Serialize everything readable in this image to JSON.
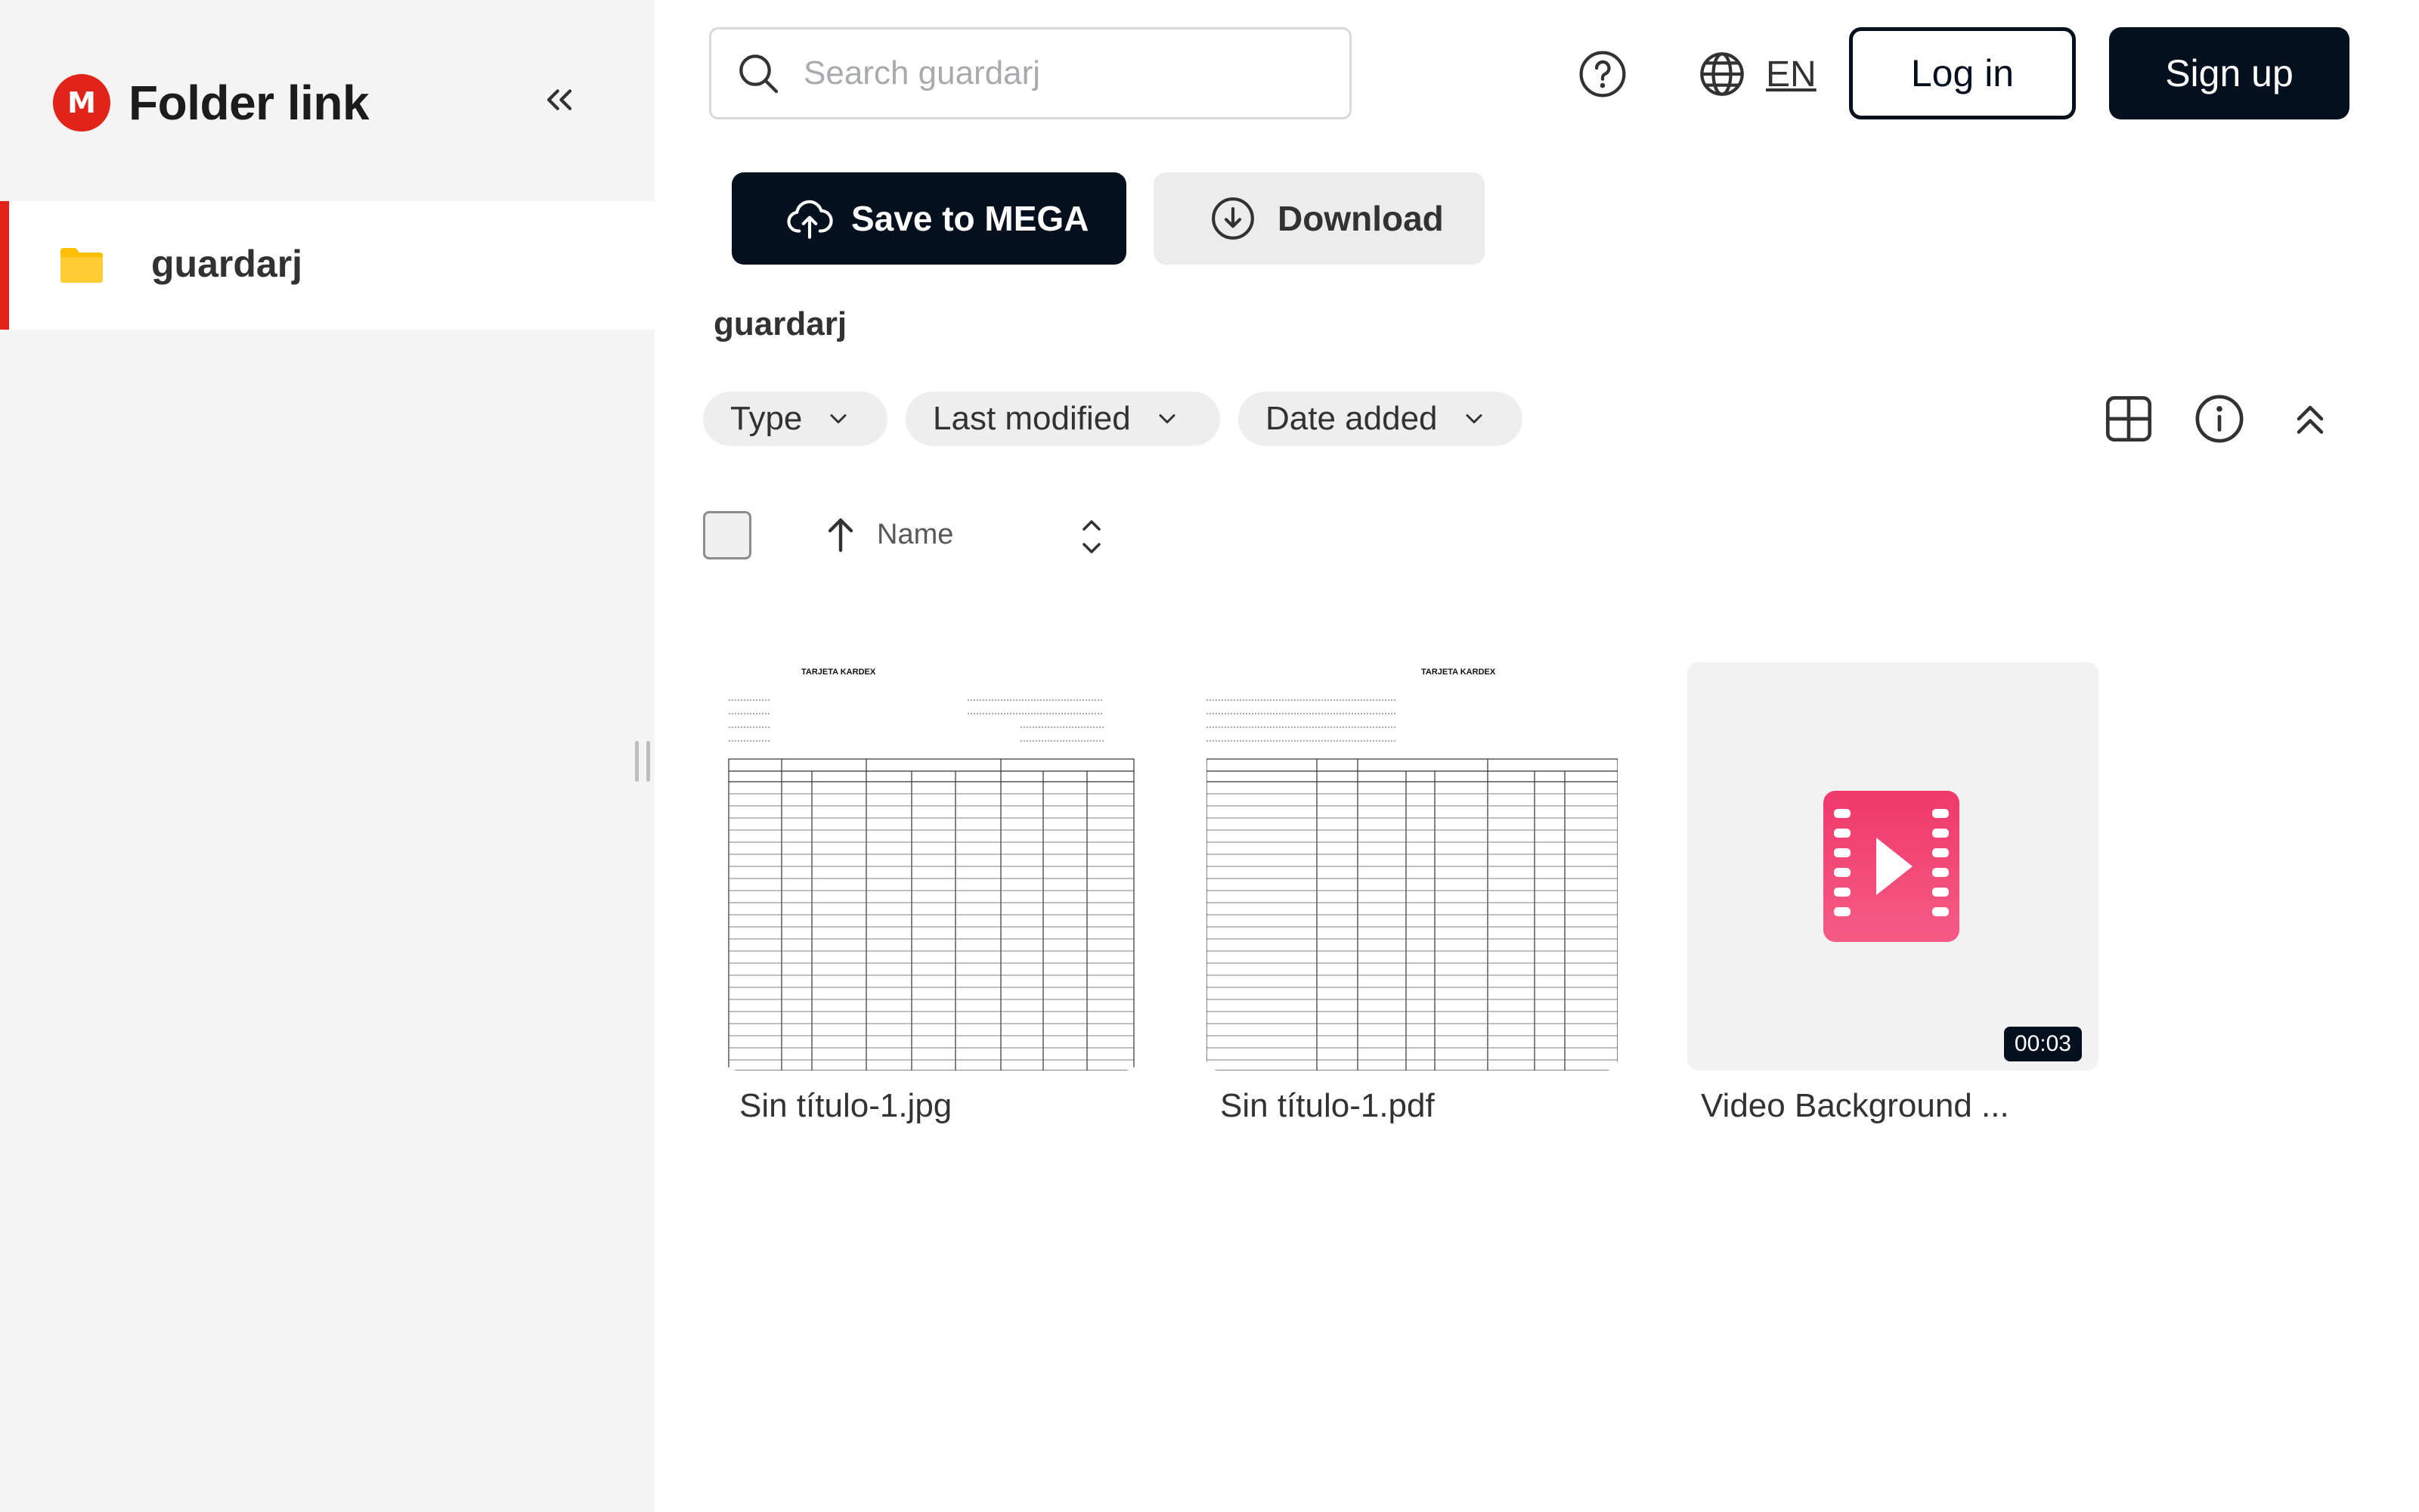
{
  "app": {
    "brand_letter": "M",
    "title": "Folder link",
    "brand_color": "#e2231a"
  },
  "sidebar": {
    "items": [
      {
        "label": "guardarj",
        "icon": "folder-icon",
        "active": true
      }
    ]
  },
  "header": {
    "search_placeholder": "Search guardarj",
    "language": "EN",
    "login_label": "Log in",
    "signup_label": "Sign up"
  },
  "actions": {
    "save_label": "Save to MEGA",
    "download_label": "Download"
  },
  "folder": {
    "name": "guardarj"
  },
  "filters": [
    {
      "label": "Type"
    },
    {
      "label": "Last modified"
    },
    {
      "label": "Date added"
    }
  ],
  "sort": {
    "label": "Name",
    "direction": "ascending"
  },
  "files": [
    {
      "name": "Sin título-1.jpg",
      "kind": "image",
      "preview_title": "TARJETA KARDEX"
    },
    {
      "name": "Sin título-1.pdf",
      "kind": "pdf",
      "preview_title": "TARJETA KARDEX"
    },
    {
      "name": "Video Background ...",
      "kind": "video",
      "duration": "00:03",
      "icon": "video-file-icon"
    }
  ],
  "colors": {
    "dark": "#04101e",
    "accent": "#e2231a",
    "video_pink": "#f0386b",
    "folder": "#ffbf00"
  }
}
